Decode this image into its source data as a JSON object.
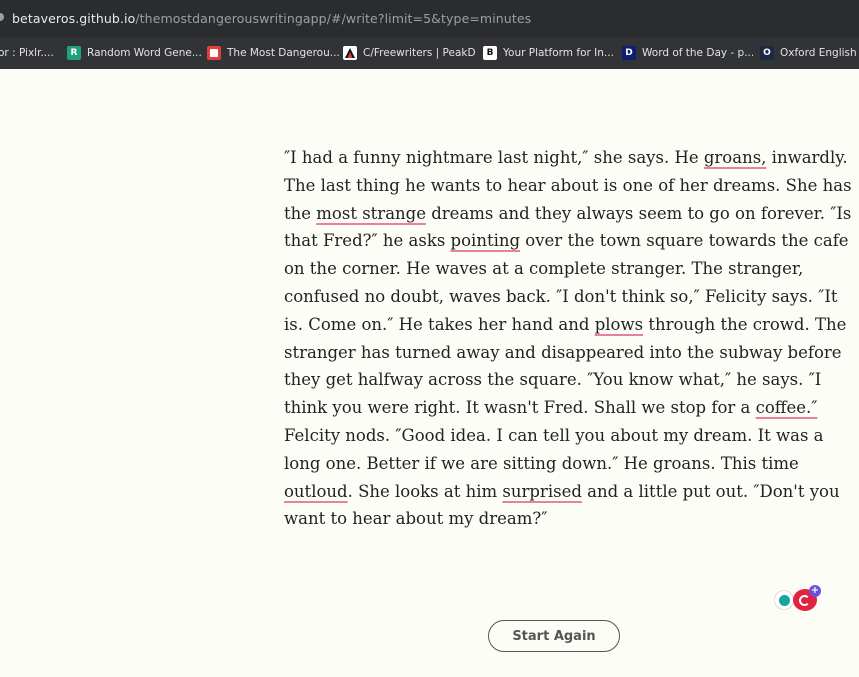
{
  "browser": {
    "url_host": "betaveros.github.io",
    "url_path": "/themostdangerouswritingapp/#/write?limit=5&type=minutes"
  },
  "bookmarks": [
    {
      "label": "or : Pixlr....",
      "icon": "none"
    },
    {
      "label": "Random Word Gene...",
      "icon": "r-letter-icon",
      "glyph": "R",
      "color": "#1fa27a"
    },
    {
      "label": "The Most Dangerou...",
      "icon": "red-square-icon",
      "color": "#e0413d"
    },
    {
      "label": "C/Freewriters | PeakD",
      "icon": "peakd-icon"
    },
    {
      "label": "Your Platform for In...",
      "icon": "b-box-icon",
      "glyph": "B"
    },
    {
      "label": "Word of the Day - p...",
      "icon": "dictionary-icon",
      "glyph": "D",
      "color": "#0d1f6e"
    },
    {
      "label": "Oxford English D",
      "icon": "oxford-icon",
      "glyph": "O",
      "color": "#1b2945"
    }
  ],
  "story": {
    "lines": [
      [
        "″I had a funny nightmare last night,″ she says. He ",
        {
          "w": "groans,"
        },
        " inwardly."
      ],
      [
        "The last thing he wants to hear about is one of her dreams. She has"
      ],
      [
        "the ",
        {
          "w": "most strange"
        },
        " dreams and they always seem to go on forever. ″Is"
      ],
      [
        "that Fred?″ he asks ",
        {
          "w": "pointing"
        },
        " over the town square towards the cafe"
      ],
      [
        "on the corner. He waves at a complete stranger. The stranger,"
      ],
      [
        "confused no doubt, waves back. ″I don't think so,″ Felicity says. ″It"
      ],
      [
        "is. Come on.″ He takes her hand and ",
        {
          "w": "plows"
        },
        " through the crowd. The"
      ],
      [
        "stranger has turned away and disappeared into the subway before"
      ],
      [
        "they get halfway across the square. ″You know what,″ he says. ″I"
      ],
      [
        "think you were right. It wasn't Fred. Shall we stop for a ",
        {
          "w": "coffee.″"
        }
      ],
      [
        "Felcity nods. ″Good idea. I can tell you about my dream. It was a"
      ],
      [
        "long one. Better if we are sitting down.″ He groans. This time"
      ],
      [
        {
          "w": "outloud"
        },
        ". She looks at him ",
        {
          "w": "surprised"
        },
        " and a little put out. ″Don't you"
      ],
      [
        "want to hear about my dream?″"
      ]
    ]
  },
  "extension": {
    "plus": "+"
  },
  "controls": {
    "start_again": "Start Again"
  }
}
